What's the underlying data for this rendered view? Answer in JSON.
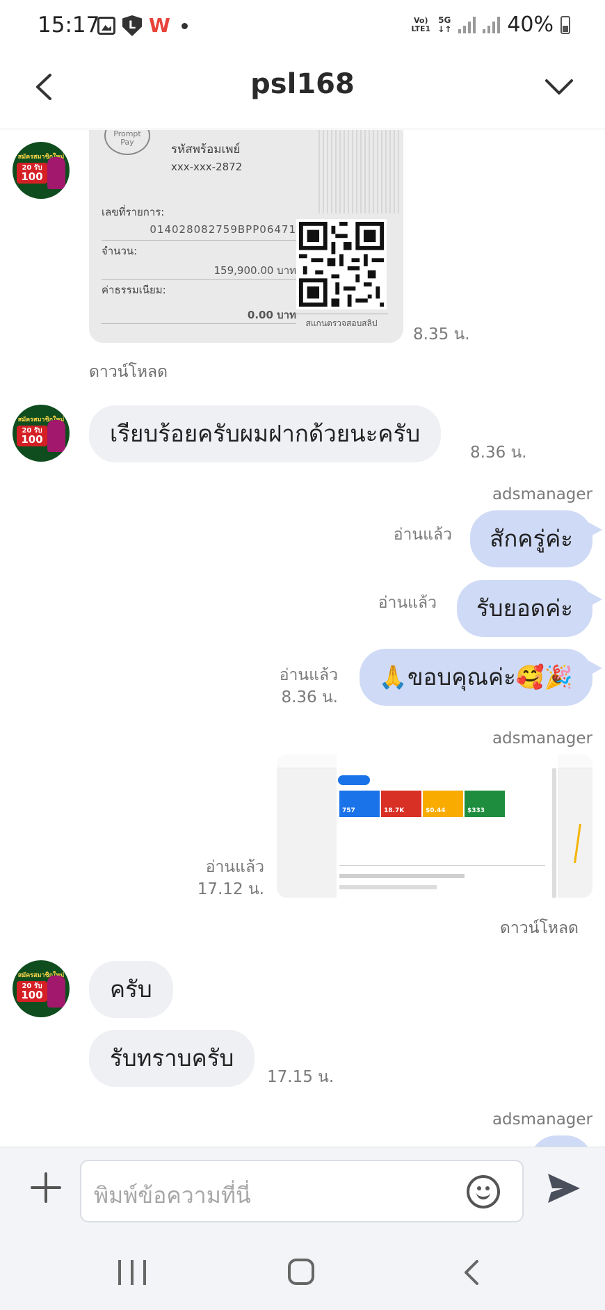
{
  "status_bar": {
    "time": "15:17",
    "battery": "40%",
    "volte_label": "Vo) LTE1",
    "network": "5G"
  },
  "header": {
    "title": "psl168"
  },
  "avatar": {
    "line1": "สมัครสมาชิกใหม่",
    "line2": "20 รับ",
    "line3": "100"
  },
  "messages": {
    "m1": {
      "type": "image",
      "kind": "promptpay-qr-receipt",
      "time": "8.35 น.",
      "download": "ดาวน์โหลด",
      "receipt": {
        "brand": "Prompt Pay",
        "line_title": "รหัสพร้อมเพย์",
        "account": "xxx-xxx-2872",
        "ref_label": "เลขที่รายการ:",
        "ref_value": "014028082759BPP06471",
        "amount_label": "จำนวน:",
        "amount_value": "159,900.00 บาท",
        "fee_label": "ค่าธรรมเนียม:",
        "fee_value": "0.00 บาท",
        "qr_caption": "สแกนตรวจสอบสลิป"
      }
    },
    "m2": {
      "type": "text",
      "text": "เรียบร้อยครับผมฝากด้วยนะครับ",
      "time": "8.36 น."
    },
    "m3": {
      "sender": "adsmanager",
      "text": "สักครู่ค่ะ",
      "read": "อ่านแล้ว"
    },
    "m4": {
      "text": "รับยอดค่ะ",
      "read": "อ่านแล้ว"
    },
    "m5": {
      "text": "🙏ขอบคุณค่ะ🥰🎉",
      "read": "อ่านแล้ว",
      "time": "8.36 น."
    },
    "m6": {
      "sender": "adsmanager",
      "type": "image",
      "kind": "ads-dashboard-screenshot",
      "read": "อ่านแล้ว",
      "time": "17.12 น.",
      "download": "ดาวน์โหลด",
      "cards": [
        {
          "value": "757",
          "color": "#1a73e8"
        },
        {
          "value": "18.7K",
          "color": "#d93025"
        },
        {
          "value": "$0.44",
          "color": "#f9ab00"
        },
        {
          "value": "$333",
          "color": "#1e8e3e"
        }
      ]
    },
    "m7": {
      "text": "ครับ"
    },
    "m8": {
      "text": "รับทราบครับ",
      "time": "17.15 น."
    },
    "m9": {
      "sender": "adsmanager"
    }
  },
  "composer": {
    "placeholder": "พิมพ์ข้อความที่นี่"
  }
}
